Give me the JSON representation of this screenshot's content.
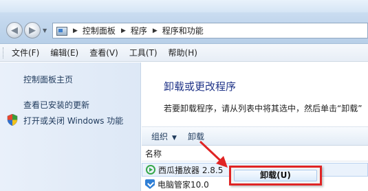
{
  "address_bar": {
    "crumbs": [
      "控制面板",
      "程序",
      "程序和功能"
    ]
  },
  "menu": {
    "items": [
      "文件(F)",
      "编辑(E)",
      "查看(V)",
      "工具(T)",
      "帮助(H)"
    ]
  },
  "sidebar": {
    "home_link": "控制面板主页",
    "updates_link": "查看已安装的更新",
    "features_link": "打开或关闭 Windows 功能"
  },
  "main": {
    "heading": "卸载或更改程序",
    "description": "若要卸载程序，请从列表中将其选中，然后单击“卸载”"
  },
  "toolbar": {
    "organize_label": "组织",
    "uninstall_label": "卸载"
  },
  "list": {
    "column_name": "名称",
    "rows": [
      {
        "name": "西瓜播放器 2.8.5",
        "icon": "xigua-player-icon"
      },
      {
        "name": "电脑管家10.0",
        "icon": "pc-manager-icon"
      }
    ]
  },
  "context_menu": {
    "uninstall_label": "卸载(U)"
  },
  "colors": {
    "annotation_red": "#e02424",
    "heading_blue": "#1e3287",
    "sidebar_bg": "#dde8f6"
  }
}
